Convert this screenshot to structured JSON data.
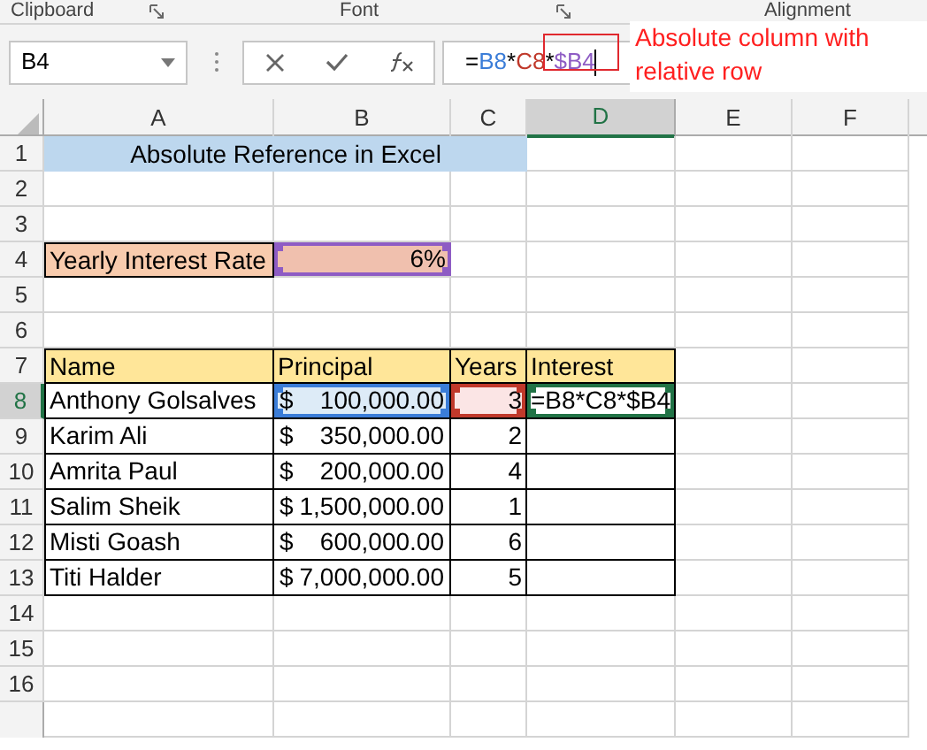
{
  "ribbon_groups": [
    "Clipboard",
    "Font",
    "Alignment"
  ],
  "name_box": {
    "value": "B4"
  },
  "formula_bar": {
    "segments": [
      {
        "text": "=",
        "color": "#000000"
      },
      {
        "text": "B8",
        "color": "#3b7dd8"
      },
      {
        "text": "*",
        "color": "#000000"
      },
      {
        "text": "C8",
        "color": "#c0392b"
      },
      {
        "text": "*",
        "color": "#000000"
      },
      {
        "text": "$B4",
        "color": "#8e5cc4"
      }
    ]
  },
  "annotation": {
    "text": "Absolute column with relative row"
  },
  "columns": [
    {
      "label": "A",
      "selected": false
    },
    {
      "label": "B",
      "selected": false
    },
    {
      "label": "C",
      "selected": false
    },
    {
      "label": "D",
      "selected": true
    },
    {
      "label": "E",
      "selected": false
    },
    {
      "label": "F",
      "selected": false
    }
  ],
  "rows": [
    {
      "label": "1",
      "selected": false,
      "cells": [
        {
          "kind": "title",
          "text": "Absolute Reference in Excel"
        }
      ]
    },
    {
      "label": "2",
      "selected": false,
      "cells": []
    },
    {
      "label": "3",
      "selected": false,
      "cells": []
    },
    {
      "label": "4",
      "selected": false,
      "cells": [
        {
          "kind": "label",
          "text": "Yearly Interest Rate"
        },
        {
          "kind": "input",
          "text": "6%",
          "color": "#8e5cc4"
        }
      ]
    },
    {
      "label": "5",
      "selected": false,
      "cells": []
    },
    {
      "label": "6",
      "selected": false,
      "cells": []
    },
    {
      "label": "7",
      "selected": false,
      "cells": [
        {
          "kind": "header",
          "text": "Name"
        },
        {
          "kind": "header",
          "text": "Principal"
        },
        {
          "kind": "header",
          "text": "Years"
        },
        {
          "kind": "header",
          "text": "Interest"
        }
      ]
    },
    {
      "label": "8",
      "selected": true,
      "cells": [
        {
          "kind": "text",
          "text": "Anthony Golsalves"
        },
        {
          "kind": "money",
          "symbol": "$",
          "text": "100,000.00",
          "color": "#3b7dd8"
        },
        {
          "kind": "number",
          "text": "3",
          "color": "#c0392b"
        },
        {
          "kind": "text",
          "text": "=B8*C8*$B4",
          "color": "#217346"
        }
      ]
    },
    {
      "label": "9",
      "selected": false,
      "cells": [
        {
          "kind": "text",
          "text": "Karim Ali"
        },
        {
          "kind": "money",
          "symbol": "$",
          "text": "350,000.00"
        },
        {
          "kind": "number",
          "text": "2"
        },
        {
          "kind": "blank"
        }
      ]
    },
    {
      "label": "10",
      "selected": false,
      "cells": [
        {
          "kind": "text",
          "text": "Amrita Paul"
        },
        {
          "kind": "money",
          "symbol": "$",
          "text": "200,000.00"
        },
        {
          "kind": "number",
          "text": "4"
        },
        {
          "kind": "blank"
        }
      ]
    },
    {
      "label": "11",
      "selected": false,
      "cells": [
        {
          "kind": "text",
          "text": "Salim Sheik"
        },
        {
          "kind": "money",
          "symbol": "$",
          "text": "1,500,000.00"
        },
        {
          "kind": "number",
          "text": "1"
        },
        {
          "kind": "blank"
        }
      ]
    },
    {
      "label": "12",
      "selected": false,
      "cells": [
        {
          "kind": "text",
          "text": "Misti Goash"
        },
        {
          "kind": "money",
          "symbol": "$",
          "text": "600,000.00"
        },
        {
          "kind": "number",
          "text": "6"
        },
        {
          "kind": "blank"
        }
      ]
    },
    {
      "label": "13",
      "selected": false,
      "cells": [
        {
          "kind": "text",
          "text": "Titi Halder"
        },
        {
          "kind": "money",
          "symbol": "$",
          "text": "7,000,000.00"
        },
        {
          "kind": "number",
          "text": "5"
        },
        {
          "kind": "blank"
        }
      ]
    },
    {
      "label": "14",
      "selected": false,
      "cells": []
    },
    {
      "label": "15",
      "selected": false,
      "cells": []
    },
    {
      "label": "16",
      "selected": false,
      "cells": []
    }
  ]
}
